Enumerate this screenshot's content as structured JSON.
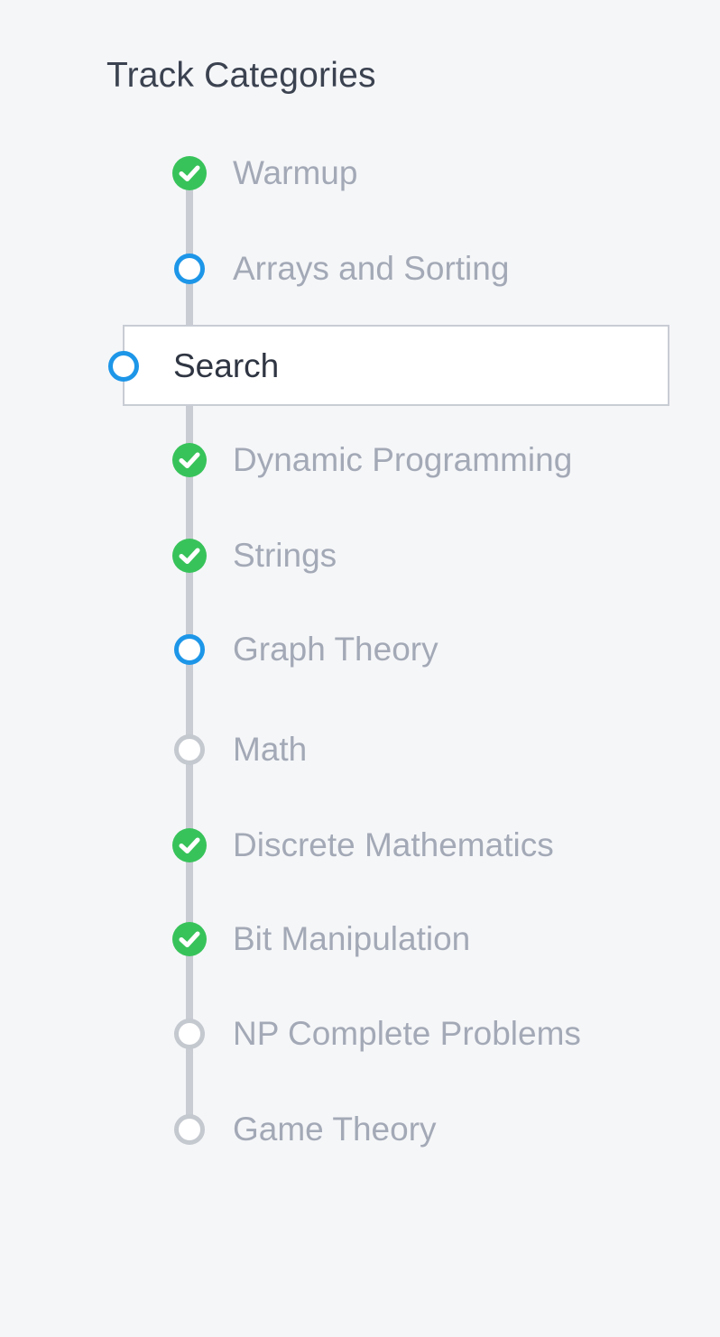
{
  "heading": "Track Categories",
  "colors": {
    "completed": "#38c35a",
    "in_progress": "#1d96e8",
    "not_started": "#c4c8cf",
    "rail": "#c9ccd3"
  },
  "items": [
    {
      "label": "Warmup",
      "status": "completed",
      "icon": "check-circle-icon"
    },
    {
      "label": "Arrays and Sorting",
      "status": "in_progress",
      "icon": "ring-icon"
    },
    {
      "label": "Search",
      "status": "in_progress",
      "icon": "ring-icon",
      "selected": true
    },
    {
      "label": "Dynamic Programming",
      "status": "completed",
      "icon": "check-circle-icon"
    },
    {
      "label": "Strings",
      "status": "completed",
      "icon": "check-circle-icon"
    },
    {
      "label": "Graph Theory",
      "status": "in_progress",
      "icon": "ring-icon"
    },
    {
      "label": "Math",
      "status": "not_started",
      "icon": "ring-icon"
    },
    {
      "label": "Discrete Mathematics",
      "status": "completed",
      "icon": "check-circle-icon"
    },
    {
      "label": "Bit Manipulation",
      "status": "completed",
      "icon": "check-circle-icon"
    },
    {
      "label": "NP Complete Problems",
      "status": "not_started",
      "icon": "ring-icon"
    },
    {
      "label": "Game Theory",
      "status": "not_started",
      "icon": "ring-icon"
    }
  ]
}
